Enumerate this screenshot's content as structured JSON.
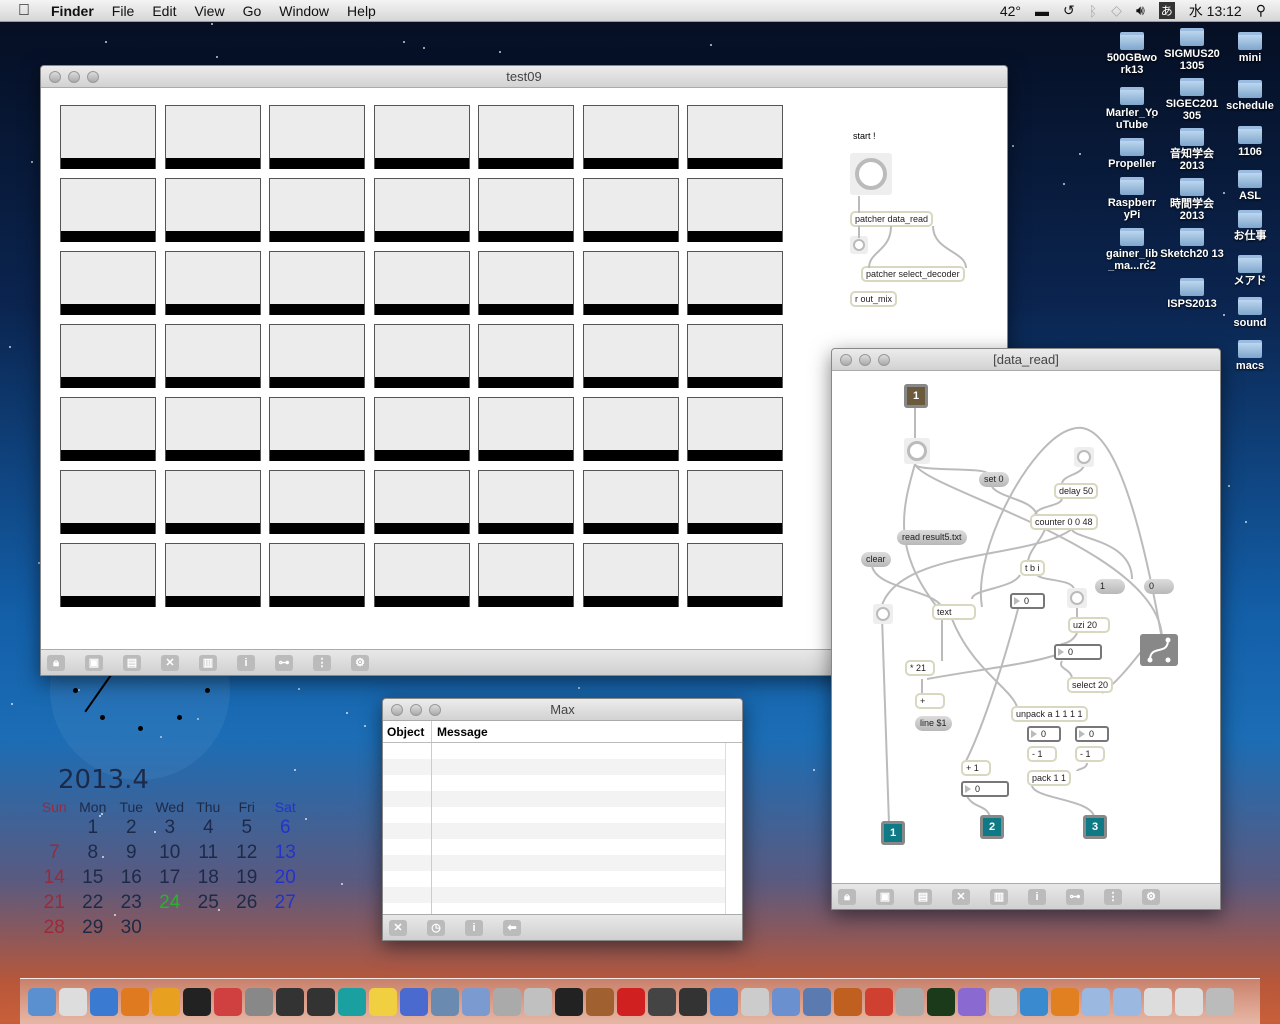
{
  "menubar": {
    "apple": "",
    "app": "Finder",
    "items": [
      "File",
      "Edit",
      "View",
      "Go",
      "Window",
      "Help"
    ],
    "temp": "42°",
    "ime": "あ",
    "clock": "水 13:12"
  },
  "desktop_icons": [
    {
      "label": "500GBwo rk13"
    },
    {
      "label": "Marler_Yo uTube"
    },
    {
      "label": "Propeller"
    },
    {
      "label": "Raspberr yPi"
    },
    {
      "label": "gainer_lib _ma...rc2"
    },
    {
      "label": "SIGMUS20 1305"
    },
    {
      "label": "SIGEC201 305"
    },
    {
      "label": "音知学会 2013"
    },
    {
      "label": "時間学会 2013"
    },
    {
      "label": "Sketch20 13"
    },
    {
      "label": "ISPS2013"
    },
    {
      "label": "mini"
    },
    {
      "label": "schedule"
    },
    {
      "label": "1106"
    },
    {
      "label": "ASL"
    },
    {
      "label": "お仕事"
    },
    {
      "label": "メアド"
    },
    {
      "label": "sound"
    },
    {
      "label": "macs"
    }
  ],
  "test09": {
    "title": "test09",
    "grid": {
      "rows": 7,
      "cols": 7
    },
    "comment": "start !",
    "objects": {
      "patcher_read": "patcher data_read",
      "patcher_select": "patcher select_decoder",
      "receive": "r out_mix"
    }
  },
  "data_read": {
    "title": "[data_read]",
    "inlet": "1",
    "outlets": [
      "1",
      "2",
      "3"
    ],
    "objects": {
      "set0": "set 0",
      "delay": "delay 50",
      "counter": "counter 0 0 48",
      "read": "read result5.txt",
      "clear": "clear",
      "tbi": "t b i",
      "msg1": "1",
      "msg0": "0",
      "num1": "0",
      "text": "text",
      "uzi": "uzi 20",
      "num2": "0",
      "mul": "* 21",
      "select": "select 20",
      "plus": "+",
      "unpack": "unpack a 1 1 1 1",
      "line": "line $1",
      "num3": "0",
      "num4": "0",
      "minus1": "- 1",
      "minus2": "- 1",
      "plus1": "+ 1",
      "pack": "pack 1 1",
      "num5": "0"
    }
  },
  "max": {
    "title": "Max",
    "columns": [
      "Object",
      "Message"
    ]
  },
  "toolbar_icons": [
    "lock",
    "new-view",
    "clipboard",
    "close",
    "chart",
    "info",
    "connect",
    "grid",
    "settings"
  ],
  "calendar": {
    "title": "2013.4",
    "weekdays": [
      "Sun",
      "Mon",
      "Tue",
      "Wed",
      "Thu",
      "Fri",
      "Sat"
    ],
    "days": [
      "",
      "1",
      "2",
      "3",
      "4",
      "5",
      "6",
      "7",
      "8",
      "9",
      "10",
      "11",
      "12",
      "13",
      "14",
      "15",
      "16",
      "17",
      "18",
      "19",
      "20",
      "21",
      "22",
      "23",
      "24",
      "25",
      "26",
      "27",
      "28",
      "29",
      "30"
    ],
    "today": "24"
  },
  "colors": {
    "sun": "#9a2a3a",
    "sat": "#2233cc",
    "today": "#2ab32a",
    "patch_outlet": "#0d7a86"
  },
  "dock": [
    "finder",
    "preview",
    "safari",
    "firefox",
    "illustrator",
    "terminal",
    "chrome",
    "disk",
    "processing",
    "processing2",
    "arduino",
    "pinwheel",
    "xcode",
    "photo",
    "pen",
    "notes",
    "image",
    "piano",
    "guitar",
    "flash",
    "itunes",
    "video",
    "mail",
    "dvd",
    "iphoto",
    "pen2",
    "box",
    "cup",
    "network",
    "activity",
    "mail2",
    "app",
    "time",
    "vlc",
    "folder1",
    "folder2",
    "folder3",
    "folder4",
    "trash"
  ]
}
